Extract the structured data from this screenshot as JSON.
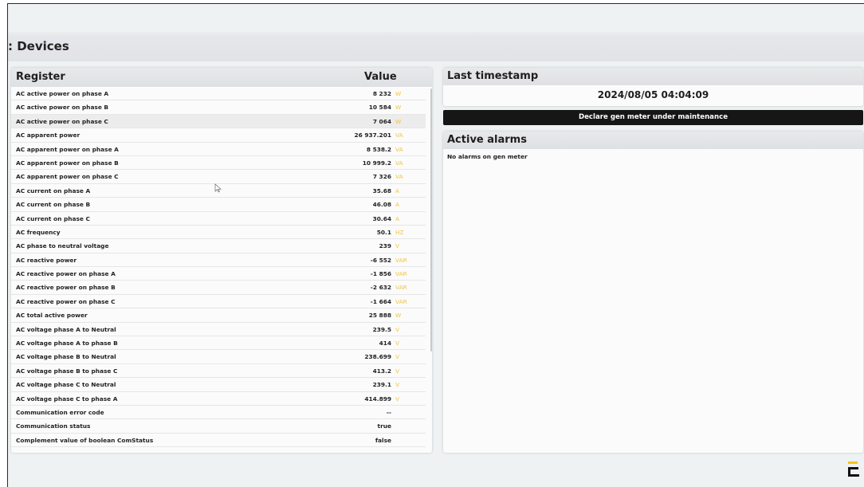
{
  "header": {
    "title": ": Devices"
  },
  "registers": {
    "col_register": "Register",
    "col_value": "Value",
    "rows": [
      {
        "register": "AC active power on phase A",
        "value": "8 232",
        "unit": "W"
      },
      {
        "register": "AC active power on phase B",
        "value": "10 584",
        "unit": "W"
      },
      {
        "register": "AC active power on phase C",
        "value": "7 064",
        "unit": "W"
      },
      {
        "register": "AC apparent power",
        "value": "26 937.201",
        "unit": "VA"
      },
      {
        "register": "AC apparent power on phase A",
        "value": "8 538.2",
        "unit": "VA"
      },
      {
        "register": "AC apparent power on phase B",
        "value": "10 999.2",
        "unit": "VA"
      },
      {
        "register": "AC apparent power on phase C",
        "value": "7 326",
        "unit": "VA"
      },
      {
        "register": "AC current on phase A",
        "value": "35.68",
        "unit": "A"
      },
      {
        "register": "AC current on phase B",
        "value": "46.08",
        "unit": "A"
      },
      {
        "register": "AC current on phase C",
        "value": "30.64",
        "unit": "A"
      },
      {
        "register": "AC frequency",
        "value": "50.1",
        "unit": "HZ"
      },
      {
        "register": "AC phase to neutral voltage",
        "value": "239",
        "unit": "V"
      },
      {
        "register": "AC reactive power",
        "value": "-6 552",
        "unit": "VAR"
      },
      {
        "register": "AC reactive power on phase A",
        "value": "-1 856",
        "unit": "VAR"
      },
      {
        "register": "AC reactive power on phase B",
        "value": "-2 632",
        "unit": "VAR"
      },
      {
        "register": "AC reactive power on phase C",
        "value": "-1 664",
        "unit": "VAR"
      },
      {
        "register": "AC total active power",
        "value": "25 888",
        "unit": "W"
      },
      {
        "register": "AC voltage phase A to Neutral",
        "value": "239.5",
        "unit": "V"
      },
      {
        "register": "AC voltage phase A to phase B",
        "value": "414",
        "unit": "V"
      },
      {
        "register": "AC voltage phase B to Neutral",
        "value": "238.699",
        "unit": "V"
      },
      {
        "register": "AC voltage phase B to phase C",
        "value": "413.2",
        "unit": "V"
      },
      {
        "register": "AC voltage phase C to Neutral",
        "value": "239.1",
        "unit": "V"
      },
      {
        "register": "AC voltage phase C to phase A",
        "value": "414.899",
        "unit": "V"
      },
      {
        "register": "Communication error code",
        "value": "--",
        "unit": ""
      },
      {
        "register": "Communication status",
        "value": "true",
        "unit": ""
      },
      {
        "register": "Complement value of boolean ComStatus",
        "value": "false",
        "unit": ""
      }
    ]
  },
  "timestamp": {
    "title": "Last timestamp",
    "value": "2024/08/05 04:04:09"
  },
  "maintenance_button": {
    "label": "Declare gen meter under maintenance"
  },
  "alarms": {
    "title": "Active alarms",
    "message": "No alarms on gen meter"
  },
  "colors": {
    "unit": "#f3c43c",
    "logo_accent": "#f5c518",
    "button_bg": "#161616"
  },
  "icons": {
    "cursor": "mouse-pointer-icon",
    "logo": "brand-logo-icon"
  }
}
